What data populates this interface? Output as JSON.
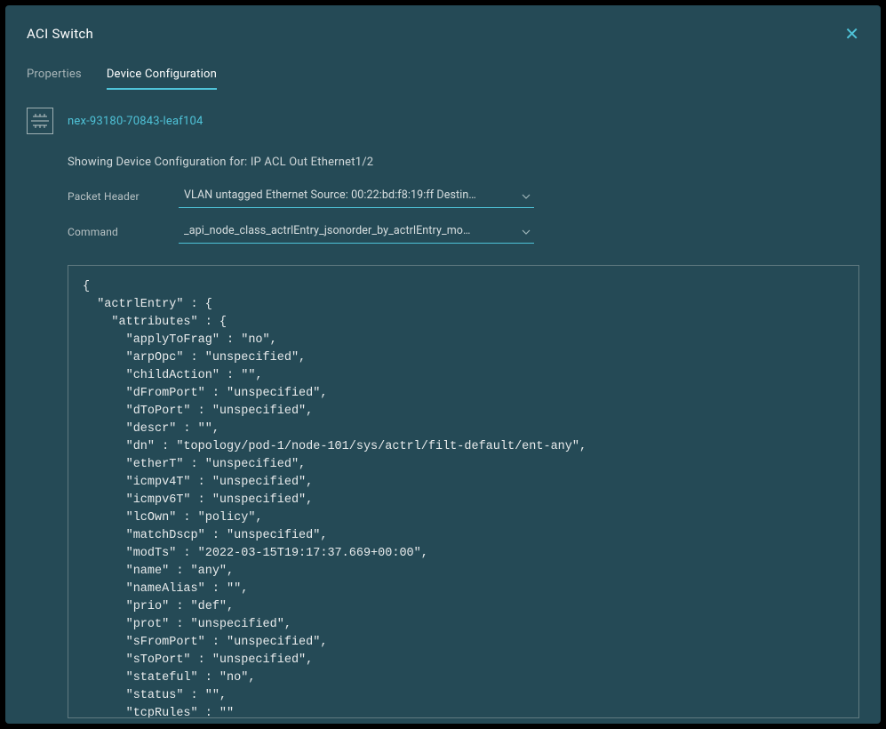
{
  "modal": {
    "title": "ACI Switch"
  },
  "tabs": {
    "properties": "Properties",
    "deviceConfig": "Device Configuration"
  },
  "device": {
    "name": "nex-93180-70843-leaf104"
  },
  "configLabel": "Showing Device Configuration for: IP ACL Out Ethernet1/2",
  "form": {
    "packetHeaderLabel": "Packet Header",
    "packetHeaderValue": "VLAN untagged Ethernet Source: 00:22:bd:f8:19:ff Destin…",
    "commandLabel": "Command",
    "commandValue": "_api_node_class_actrlEntry_jsonorder_by_actrlEntry_mo…"
  },
  "codeContent": "{\n  \"actrlEntry\" : {\n    \"attributes\" : {\n      \"applyToFrag\" : \"no\",\n      \"arpOpc\" : \"unspecified\",\n      \"childAction\" : \"\",\n      \"dFromPort\" : \"unspecified\",\n      \"dToPort\" : \"unspecified\",\n      \"descr\" : \"\",\n      \"dn\" : \"topology/pod-1/node-101/sys/actrl/filt-default/ent-any\",\n      \"etherT\" : \"unspecified\",\n      \"icmpv4T\" : \"unspecified\",\n      \"icmpv6T\" : \"unspecified\",\n      \"lcOwn\" : \"policy\",\n      \"matchDscp\" : \"unspecified\",\n      \"modTs\" : \"2022-03-15T19:17:37.669+00:00\",\n      \"name\" : \"any\",\n      \"nameAlias\" : \"\",\n      \"prio\" : \"def\",\n      \"prot\" : \"unspecified\",\n      \"sFromPort\" : \"unspecified\",\n      \"sToPort\" : \"unspecified\",\n      \"stateful\" : \"no\",\n      \"status\" : \"\",\n      \"tcpRules\" : \"\""
}
